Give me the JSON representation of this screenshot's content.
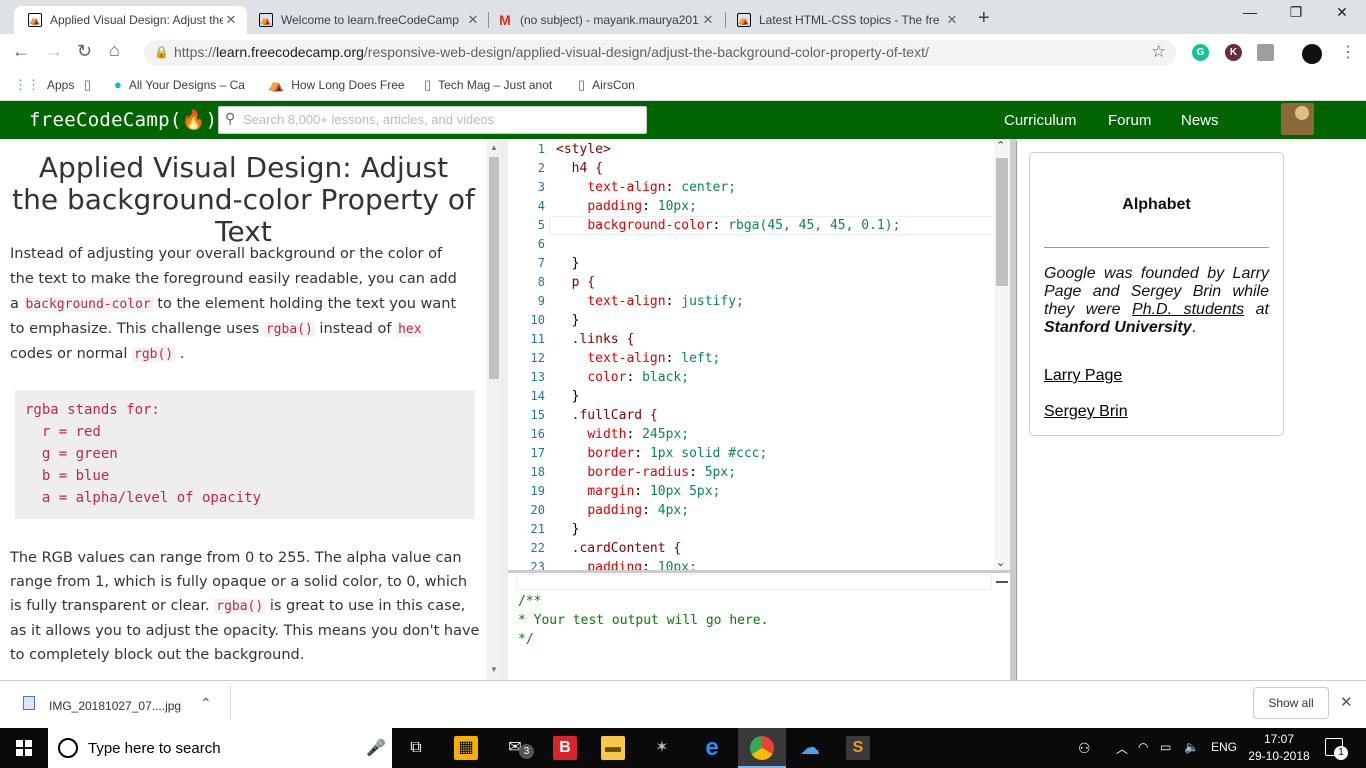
{
  "tabs": [
    {
      "title": "Applied Visual Design: Adjust the",
      "favicon": "freecodecamp-icon",
      "active": true
    },
    {
      "title": "Welcome to learn.freeCodeCamp",
      "favicon": "freecodecamp-icon"
    },
    {
      "title": "(no subject) - mayank.maurya201",
      "favicon": "gmail-icon"
    },
    {
      "title": "Latest HTML-CSS topics - The fre",
      "favicon": "freecodecamp-icon"
    }
  ],
  "window_controls": {
    "minimize": "—",
    "restore": "❐",
    "close": "✕"
  },
  "address": {
    "scheme": "https://",
    "host": "learn.freecodecamp.org",
    "path": "/responsive-web-design/applied-visual-design/adjust-the-background-color-property-of-text/"
  },
  "extensions": [
    {
      "label": "G",
      "color": "#15c39a"
    },
    {
      "label": "K",
      "color": "#6b2b3a"
    },
    {
      "label": "",
      "color": "#9e9e9e"
    },
    {
      "label": "",
      "color": "#111111"
    }
  ],
  "bookmarks": [
    {
      "label": "Apps",
      "icon": "apps-grid-icon"
    },
    {
      "label": "",
      "icon": "page-icon"
    },
    {
      "label": "All Your Designs – Ca",
      "icon": "canva-icon"
    },
    {
      "label": "How Long Does Free",
      "icon": "freecodecamp-icon"
    },
    {
      "label": "Tech Mag – Just anot",
      "icon": "page-icon"
    },
    {
      "label": "AirsCon",
      "icon": "page-icon"
    }
  ],
  "fcc": {
    "logo": "freeCodeCamp(🔥)",
    "search_placeholder": "Search 8,000+ lessons, articles, and videos",
    "nav": [
      "Curriculum",
      "Forum",
      "News"
    ]
  },
  "lesson": {
    "title": "Applied Visual Design: Adjust the background-color Property of Text",
    "p1_a": "Instead of adjusting your overall background or the color of the text to make the foreground easily readable, you can add a ",
    "p1_code1": "background-color",
    "p1_b": " to the element holding the text you want to emphasize. This challenge uses ",
    "p1_code2": "rgba()",
    "p1_c": " instead of ",
    "p1_code3": "hex",
    "p1_d": " codes or normal ",
    "p1_code4": "rgb()",
    "p1_e": " .",
    "pre": "rgba stands for:\n  r = red\n  g = green\n  b = blue\n  a = alpha/level of opacity",
    "p2_a": "The RGB values can range from 0 to 255. The alpha value can range from 1, which is fully opaque or a solid color, to 0, which is fully transparent or clear. ",
    "p2_code": "rgba()",
    "p2_b": " is great to use in this case, as it allows you to adjust the opacity. This means you don't have to completely block out the background."
  },
  "editor": {
    "lines": [
      "<style>",
      "  h4 {",
      "    text-align: center;",
      "    padding: 10px;",
      "    background-color: rbga(45, 45, 45, 0.1);",
      "",
      "  }",
      "  p {",
      "    text-align: justify;",
      "  }",
      "  .links {",
      "    text-align: left;",
      "    color: black;",
      "  }",
      "  .fullCard {",
      "    width: 245px;",
      "    border: 1px solid #ccc;",
      "    border-radius: 5px;",
      "    margin: 10px 5px;",
      "    padding: 4px;",
      "  }",
      "  .cardContent {",
      "    padding: 10px;"
    ],
    "output": "/**\n* Your test output will go here.\n*/"
  },
  "preview": {
    "heading": "Alphabet",
    "p_a": "Google was founded by Larry Page and Sergey Brin while they were ",
    "p_u": "Ph.D. students",
    "p_b": " at ",
    "p_strong": "Stanford University",
    "p_c": ".",
    "links": [
      "Larry Page",
      "Sergey Brin"
    ]
  },
  "download": {
    "filename": "IMG_20181027_07....jpg",
    "show_all": "Show all"
  },
  "taskbar": {
    "search_placeholder": "Type here to search",
    "lang": "ENG",
    "time": "17:07",
    "date": "29-10-2018",
    "notifications": "1",
    "mail_badge": "3"
  }
}
